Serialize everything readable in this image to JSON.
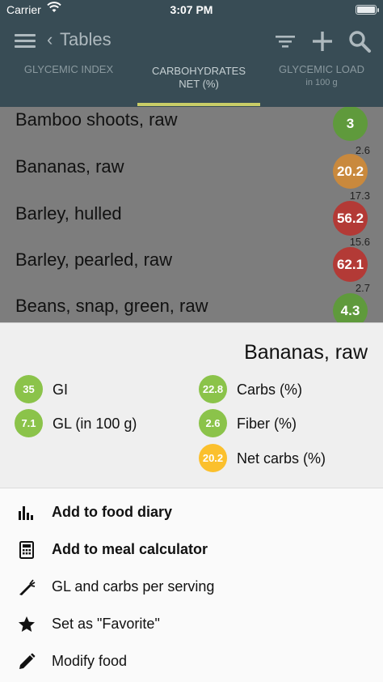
{
  "status_bar": {
    "carrier": "Carrier",
    "time": "3:07 PM"
  },
  "header": {
    "title": "Tables"
  },
  "tabs": [
    {
      "label": "GLYCEMIC INDEX",
      "sub": ""
    },
    {
      "label": "CARBOHYDRATES",
      "sub": "NET (%)"
    },
    {
      "label": "GLYCEMIC LOAD",
      "sub": "in 100 g"
    }
  ],
  "foods": [
    {
      "name": "Bamboo shoots, raw",
      "gl": "",
      "value": "3",
      "color": "#5f9a3c"
    },
    {
      "name": "Bananas, raw",
      "gl": "2.6",
      "value": "20.2",
      "color": "#c9893d"
    },
    {
      "name": "Barley, hulled",
      "gl": "17.3",
      "value": "56.2",
      "color": "#b33a36"
    },
    {
      "name": "Barley, pearled, raw",
      "gl": "15.6",
      "value": "62.1",
      "color": "#b33a36"
    },
    {
      "name": "Beans, snap, green, raw",
      "gl": "2.7",
      "value": "4.3",
      "color": "#5f9a3c"
    }
  ],
  "detail": {
    "title": "Bananas, raw",
    "stats": {
      "gi": {
        "value": "35",
        "label": "GI",
        "color": "#8bc34a"
      },
      "gl": {
        "value": "7.1",
        "label": "GL (in 100 g)",
        "color": "#8bc34a"
      },
      "carbs": {
        "value": "22.8",
        "label": "Carbs (%)",
        "color": "#8bc34a"
      },
      "fiber": {
        "value": "2.6",
        "label": "Fiber (%)",
        "color": "#8bc34a"
      },
      "net": {
        "value": "20.2",
        "label": "Net carbs (%)",
        "color": "#fbc02d"
      }
    },
    "actions": [
      {
        "label": "Add to food diary",
        "icon": "bar-chart-icon"
      },
      {
        "label": "Add to meal calculator",
        "icon": "calculator-icon"
      },
      {
        "label": "GL and carbs per serving",
        "icon": "carrot-icon"
      },
      {
        "label": "Set as \"Favorite\"",
        "icon": "star-icon"
      },
      {
        "label": "Modify food",
        "icon": "pencil-icon"
      }
    ]
  }
}
